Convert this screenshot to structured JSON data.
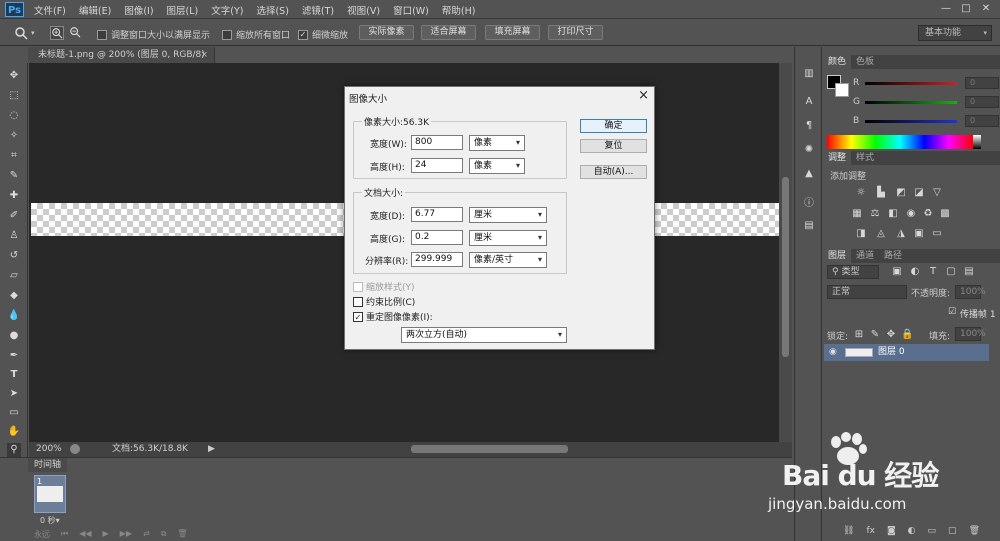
{
  "app": {
    "logo": "Ps",
    "menu": [
      "文件(F)",
      "编辑(E)",
      "图像(I)",
      "图层(L)",
      "文字(Y)",
      "选择(S)",
      "滤镜(T)",
      "视图(V)",
      "窗口(W)",
      "帮助(H)"
    ],
    "window_controls": [
      "—",
      "□",
      "✕"
    ]
  },
  "options_bar": {
    "resize_windows_label": "调整窗口大小以满屏显示",
    "resize_windows_checked": false,
    "zoom_all_label": "缩放所有窗口",
    "zoom_all_checked": false,
    "scrubby_zoom_label": "细微缩放",
    "scrubby_zoom_checked": true,
    "actual_pixels": "实际像素",
    "fit_screen": "适合屏幕",
    "fill_screen": "填充屏幕",
    "print_size": "打印尺寸",
    "workspace": "基本功能"
  },
  "document": {
    "tab_title": "未标题-1.png @ 200% (图层 0, RGB/8)",
    "zoom": "200%",
    "doc_info": "文档:56.3K/18.8K"
  },
  "timeline": {
    "title": "时间轴",
    "frame_number": "1",
    "frame_time": "0 秒▾",
    "loop": "永远"
  },
  "dialog": {
    "title": "图像大小",
    "pixel_dimensions_label": "像素大小:56.3K",
    "width_label": "宽度(W):",
    "width_value": "800",
    "width_unit": "像素",
    "height_label": "高度(H):",
    "height_value": "24",
    "height_unit": "像素",
    "document_size_label": "文档大小:",
    "doc_width_label": "宽度(D):",
    "doc_width_value": "6.77",
    "doc_width_unit": "厘米",
    "doc_height_label": "高度(G):",
    "doc_height_value": "0.2",
    "doc_height_unit": "厘米",
    "resolution_label": "分辨率(R):",
    "resolution_value": "299.999",
    "resolution_unit": "像素/英寸",
    "scale_styles_label": "缩放样式(Y)",
    "constrain_label": "约束比例(C)",
    "resample_label": "重定图像像素(I):",
    "resample_method": "两次立方(自动)",
    "ok": "确定",
    "reset": "复位",
    "auto": "自动(A)...",
    "scale_styles_checked": false,
    "constrain_checked": false,
    "resample_checked": true
  },
  "color_panel": {
    "tab_color": "颜色",
    "tab_swatches": "色板",
    "r_label": "R",
    "g_label": "G",
    "b_label": "B",
    "r_value": "0",
    "g_value": "0",
    "b_value": "0"
  },
  "adjustments_panel": {
    "tab_adjustments": "调整",
    "tab_styles": "样式",
    "add_adjustment": "添加调整"
  },
  "layers_panel": {
    "tab_layers": "图层",
    "tab_channels": "通道",
    "tab_paths": "路径",
    "kind_label": "类型",
    "blend_mode": "正常",
    "opacity_label": "不透明度:",
    "opacity_value": "100%",
    "propagate_label": "传播帧 1",
    "lock_label": "锁定:",
    "fill_label": "填充:",
    "fill_value": "100%",
    "layer_name": "图层 0"
  },
  "watermark": {
    "brand": "Bai du 经验",
    "url": "jingyan.baidu.com"
  },
  "colors": {
    "accent_blue": "#3c7fb1",
    "selection_row": "#5a6f8f",
    "slider_r": "#cc2222",
    "slider_g": "#22aa22",
    "slider_b": "#2233cc"
  }
}
